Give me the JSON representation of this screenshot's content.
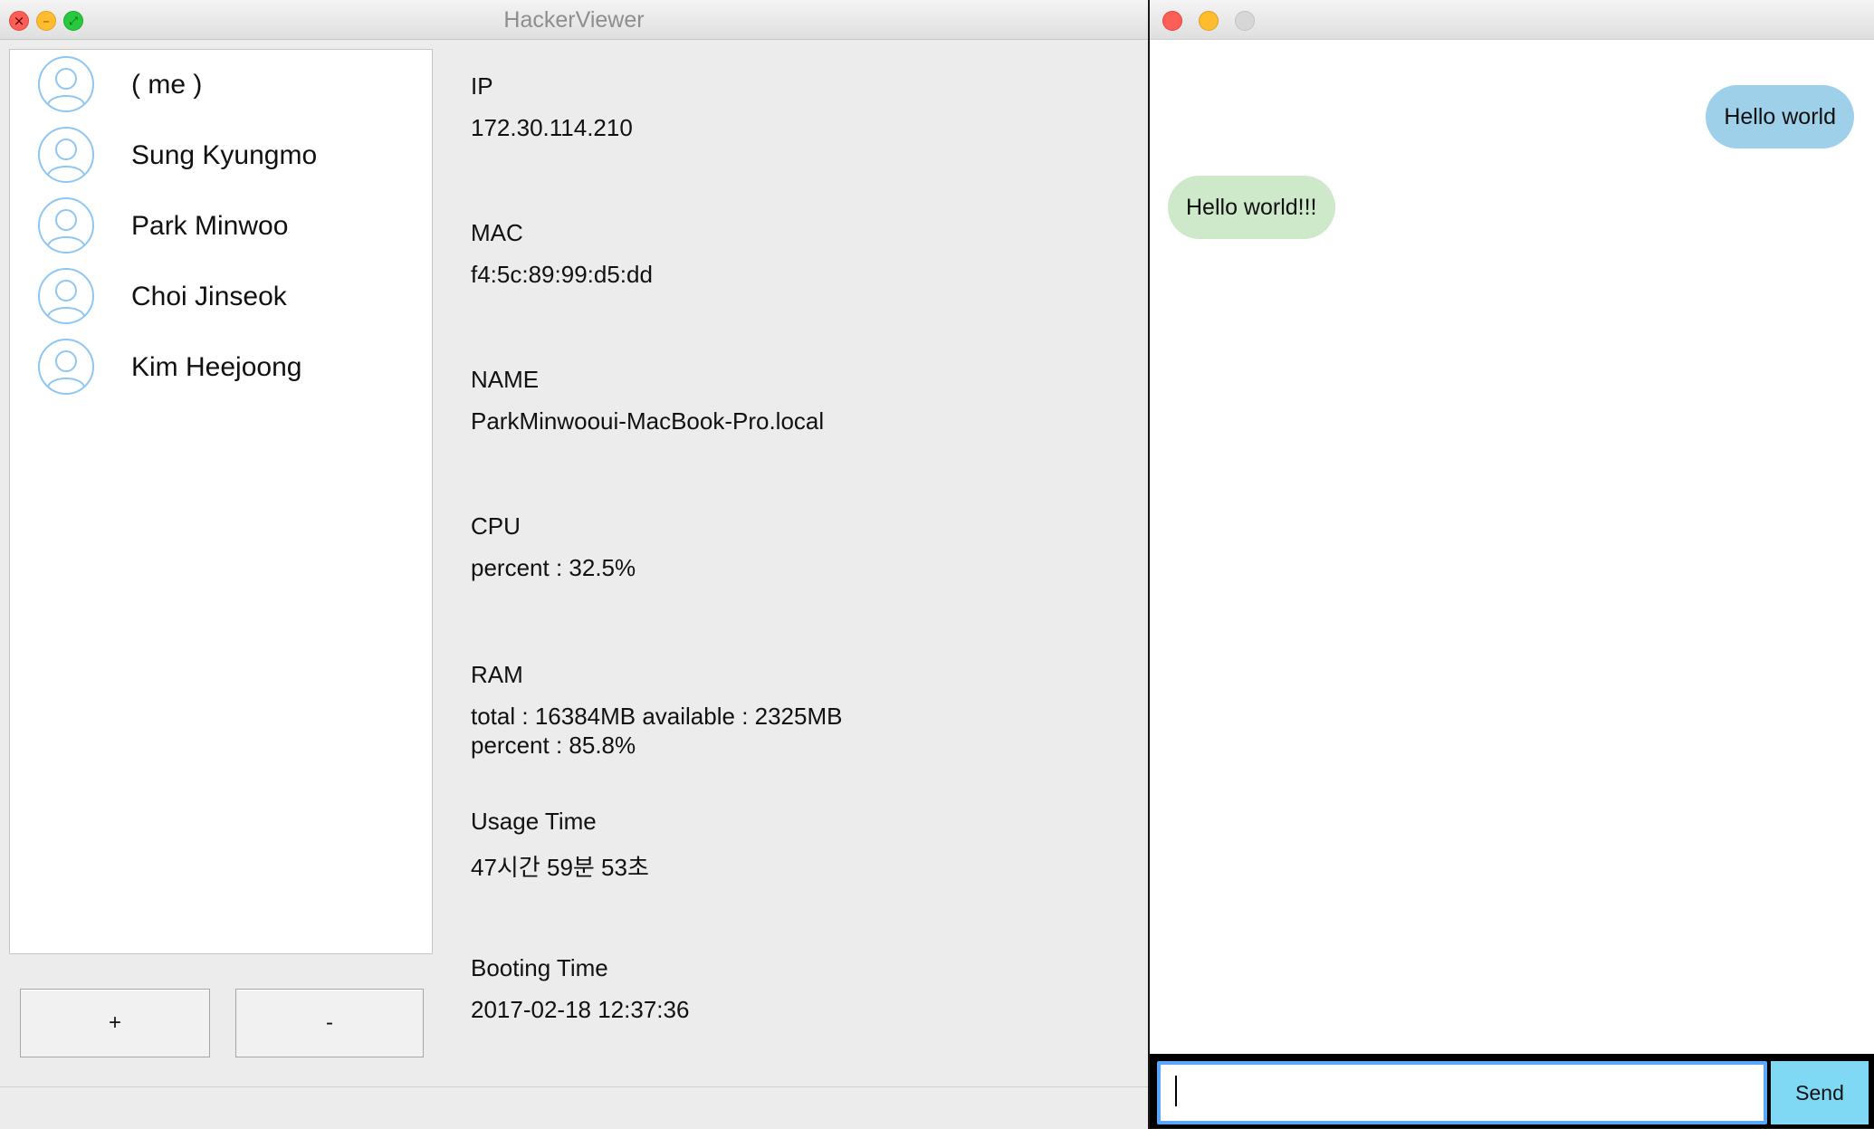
{
  "left_window": {
    "title": "HackerViewer",
    "contacts": [
      {
        "name": "( me )"
      },
      {
        "name": "Sung Kyungmo"
      },
      {
        "name": "Park Minwoo"
      },
      {
        "name": "Choi Jinseok"
      },
      {
        "name": "Kim Heejoong"
      }
    ],
    "add_button_label": "+",
    "remove_button_label": "-",
    "info": {
      "ip": {
        "label": "IP",
        "value": "172.30.114.210"
      },
      "mac": {
        "label": "MAC",
        "value": "f4:5c:89:99:d5:dd"
      },
      "name": {
        "label": "NAME",
        "value": "ParkMinwooui-MacBook-Pro.local"
      },
      "cpu": {
        "label": "CPU",
        "value": "percent : 32.5%"
      },
      "ram": {
        "label": "RAM",
        "value": "total : 16384MB  available : 2325MB",
        "value2": "percent : 85.8%"
      },
      "usage_time": {
        "label": "Usage Time",
        "value": "47시간 59분 53초"
      },
      "booting_time": {
        "label": "Booting Time",
        "value": "2017-02-18 12:37:36"
      }
    }
  },
  "chat_window": {
    "messages": [
      {
        "direction": "outgoing",
        "text": "Hello world"
      },
      {
        "direction": "incoming",
        "text": "Hello world!!!"
      }
    ],
    "input_value": "",
    "send_label": "Send"
  },
  "icons": {
    "contact_avatar": "user-avatar-icon"
  },
  "colors": {
    "outgoing_bubble": "#9fd0ea",
    "incoming_bubble": "#cde9c9",
    "send_button": "#7fd9f4",
    "input_focus": "#5aa7ff",
    "avatar_stroke": "#8ec6f4"
  }
}
